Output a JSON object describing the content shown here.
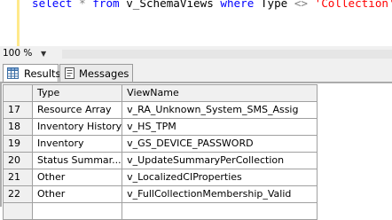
{
  "editor": {
    "line": {
      "kw_select": "select",
      "star": "*",
      "kw_from": "from",
      "table": "v_SchemaViews",
      "kw_where": "where",
      "column": "Type",
      "operator": "<>",
      "literal": "'Collection'"
    }
  },
  "zoom": {
    "value": "100 %"
  },
  "tabs": [
    {
      "label": "Results",
      "icon": "grid-icon",
      "active": true
    },
    {
      "label": "Messages",
      "icon": "messages-icon",
      "active": false
    }
  ],
  "grid": {
    "columns": [
      "Type",
      "ViewName"
    ],
    "rows": [
      {
        "num": "17",
        "type": "Resource Array",
        "view": "v_RA_Unknown_System_SMS_Assig"
      },
      {
        "num": "18",
        "type": "Inventory History",
        "view": "v_HS_TPM"
      },
      {
        "num": "19",
        "type": "Inventory",
        "view": "v_GS_DEVICE_PASSWORD"
      },
      {
        "num": "20",
        "type": "Status Summar...",
        "view": "v_UpdateSummaryPerCollection"
      },
      {
        "num": "21",
        "type": "Other",
        "view": "v_LocalizedCIProperties"
      },
      {
        "num": "22",
        "type": "Other",
        "view": "v_FullCollectionMembership_Valid"
      }
    ]
  },
  "colors": {
    "keyword": "#0000ff",
    "string": "#ff0000",
    "operator": "#808080",
    "grid_border": "#a0a0a0",
    "header_bg": "#f0f0f0"
  }
}
